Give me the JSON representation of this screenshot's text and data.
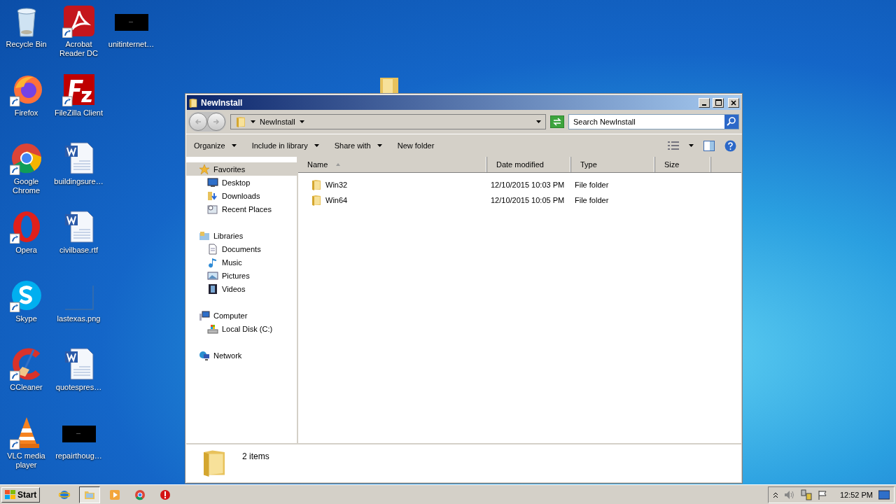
{
  "desktop_icons": [
    {
      "label": "Recycle Bin",
      "kind": "recycle",
      "shortcut": false
    },
    {
      "label": "Firefox",
      "kind": "firefox",
      "shortcut": true
    },
    {
      "label": "Google Chrome",
      "kind": "chrome",
      "shortcut": true
    },
    {
      "label": "Opera",
      "kind": "opera",
      "shortcut": true
    },
    {
      "label": "Skype",
      "kind": "skype",
      "shortcut": true
    },
    {
      "label": "CCleaner",
      "kind": "ccleaner",
      "shortcut": true
    },
    {
      "label": "VLC media player",
      "kind": "vlc",
      "shortcut": true
    },
    {
      "label": "Acrobat Reader DC",
      "kind": "acrobat",
      "shortcut": true
    },
    {
      "label": "FileZilla Client",
      "kind": "filezilla",
      "shortcut": true
    },
    {
      "label": "buildingsure…",
      "kind": "word",
      "shortcut": false
    },
    {
      "label": "civilbase.rtf",
      "kind": "word",
      "shortcut": false
    },
    {
      "label": "lastexas.png",
      "kind": "blank",
      "shortcut": false
    },
    {
      "label": "quotespres…",
      "kind": "word",
      "shortcut": false
    },
    {
      "label": "repairthoug…",
      "kind": "dark",
      "shortcut": false
    },
    {
      "label": "unitinternet…",
      "kind": "dark",
      "shortcut": false
    }
  ],
  "window": {
    "title": "NewInstall",
    "address": {
      "segments": [
        "NewInstall"
      ]
    },
    "search": {
      "placeholder": "Search NewInstall"
    },
    "toolbar": [
      {
        "label": "Organize",
        "dropdown": true
      },
      {
        "label": "Include in library",
        "dropdown": true
      },
      {
        "label": "Share with",
        "dropdown": true
      },
      {
        "label": "New folder",
        "dropdown": false
      }
    ],
    "navigation": [
      {
        "label": "Favorites",
        "kind": "star",
        "selected": true,
        "children": [
          {
            "label": "Desktop",
            "kind": "desktop",
            "selected": false
          },
          {
            "label": "Downloads",
            "kind": "downloads",
            "selected": false
          },
          {
            "label": "Recent Places",
            "kind": "recent",
            "selected": false
          }
        ]
      },
      {
        "label": "Libraries",
        "kind": "libraries",
        "selected": false,
        "children": [
          {
            "label": "Documents",
            "kind": "documents",
            "selected": false
          },
          {
            "label": "Music",
            "kind": "music",
            "selected": false
          },
          {
            "label": "Pictures",
            "kind": "pictures",
            "selected": false
          },
          {
            "label": "Videos",
            "kind": "videos",
            "selected": false
          }
        ]
      },
      {
        "label": "Computer",
        "kind": "computer",
        "selected": false,
        "children": [
          {
            "label": "Local Disk (C:)",
            "kind": "disk",
            "selected": false
          }
        ]
      },
      {
        "label": "Network",
        "kind": "network",
        "selected": false
      }
    ],
    "columns": [
      {
        "label": "Name",
        "sorted": true
      },
      {
        "label": "Date modified",
        "sorted": false
      },
      {
        "label": "Type",
        "sorted": false
      },
      {
        "label": "Size",
        "sorted": false
      }
    ],
    "rows": [
      {
        "name": "Win32",
        "date_modified": "12/10/2015 10:03 PM",
        "type": "File folder",
        "selected": false
      },
      {
        "name": "Win64",
        "date_modified": "12/10/2015 10:05 PM",
        "type": "File folder",
        "selected": false
      }
    ],
    "status": "2 items"
  },
  "taskbar": {
    "start": "Start",
    "apps": [
      {
        "kind": "ie",
        "active": false
      },
      {
        "kind": "explorer",
        "active": true
      },
      {
        "kind": "media",
        "active": false
      },
      {
        "kind": "chrome",
        "active": false
      },
      {
        "kind": "stop",
        "active": false
      }
    ],
    "clock": "12:52 PM"
  }
}
